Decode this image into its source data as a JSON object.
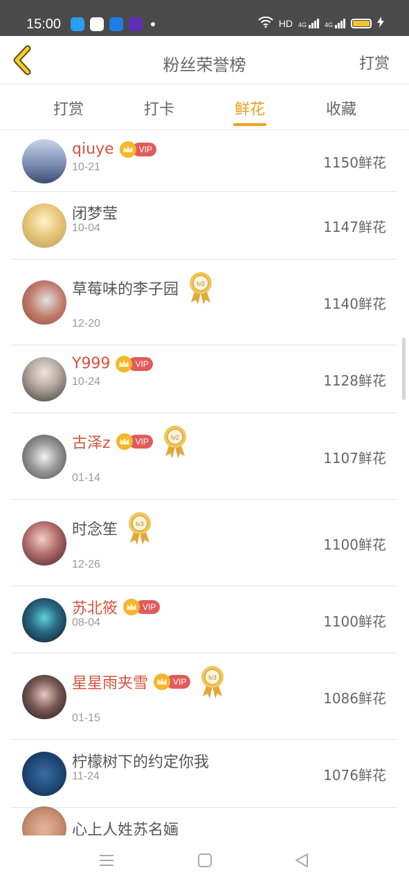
{
  "status_bar": {
    "time": "15:00",
    "network_label": "HD",
    "signal_1": "4G",
    "signal_2": "4G"
  },
  "header": {
    "title": "粉丝荣誉榜",
    "action": "打赏"
  },
  "tabs": [
    {
      "label": "打赏"
    },
    {
      "label": "打卡"
    },
    {
      "label": "鲜花"
    },
    {
      "label": "收藏"
    }
  ],
  "active_tab": "鲜花",
  "colors": {
    "accent": "#f0a019",
    "vip_name": "#d9523a",
    "vip_badge": "#e25b5b",
    "medal_gold": "#e3b64a"
  },
  "fans": [
    {
      "name": "qiuye",
      "date": "10-21",
      "amount": "1150鲜花",
      "vip": true,
      "vip_label": "VIP",
      "medal": null
    },
    {
      "name": "闭梦莹",
      "date": "10-04",
      "amount": "1147鲜花",
      "vip": false,
      "vip_label": null,
      "medal": null
    },
    {
      "name": "草莓味的李子园",
      "date": "12-20",
      "amount": "1140鲜花",
      "vip": false,
      "vip_label": null,
      "medal": "lv3"
    },
    {
      "name": "Y999",
      "date": "10-24",
      "amount": "1128鲜花",
      "vip": true,
      "vip_label": "VIP",
      "medal": null
    },
    {
      "name": "古泽z",
      "date": "01-14",
      "amount": "1107鲜花",
      "vip": true,
      "vip_label": "VIP",
      "medal": "lv2"
    },
    {
      "name": "时念笙",
      "date": "12-26",
      "amount": "1100鲜花",
      "vip": false,
      "vip_label": null,
      "medal": "lv3"
    },
    {
      "name": "苏北筱",
      "date": "08-04",
      "amount": "1100鲜花",
      "vip": true,
      "vip_label": "VIP",
      "medal": null
    },
    {
      "name": "星星雨夹雪",
      "date": "01-15",
      "amount": "1086鲜花",
      "vip": true,
      "vip_label": "VIP",
      "medal": "lv3"
    },
    {
      "name": "柠檬树下的约定你我",
      "date": "11-24",
      "amount": "1076鲜花",
      "vip": false,
      "vip_label": null,
      "medal": null
    },
    {
      "name": "心上人姓苏名婳",
      "date": "",
      "amount": "",
      "vip": false,
      "vip_label": null,
      "medal": null
    }
  ]
}
